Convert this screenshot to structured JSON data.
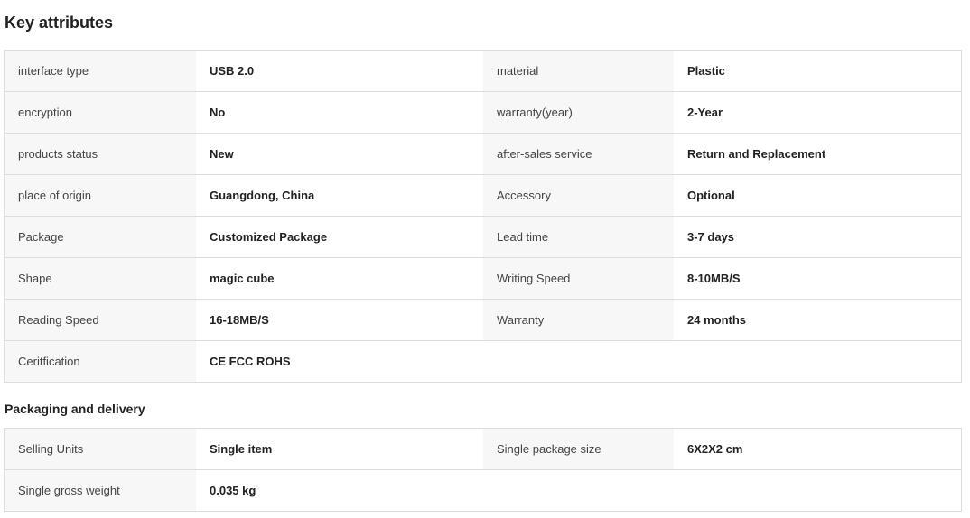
{
  "key_attributes": {
    "title": "Key attributes",
    "rows": [
      {
        "l1": "interface type",
        "v1": "USB 2.0",
        "l2": "material",
        "v2": "Plastic"
      },
      {
        "l1": "encryption",
        "v1": "No",
        "l2": "warranty(year)",
        "v2": "2-Year"
      },
      {
        "l1": "products status",
        "v1": "New",
        "l2": "after-sales service",
        "v2": "Return and Replacement"
      },
      {
        "l1": "place of origin",
        "v1": "Guangdong, China",
        "l2": "Accessory",
        "v2": "Optional"
      },
      {
        "l1": "Package",
        "v1": "Customized Package",
        "l2": "Lead time",
        "v2": "3-7 days"
      },
      {
        "l1": "Shape",
        "v1": "magic cube",
        "l2": "Writing Speed",
        "v2": "8-10MB/S"
      },
      {
        "l1": "Reading Speed",
        "v1": "16-18MB/S",
        "l2": "Warranty",
        "v2": "24 months"
      },
      {
        "l1": "Ceritfication",
        "v1": "CE FCC ROHS"
      }
    ]
  },
  "packaging": {
    "title": "Packaging and delivery",
    "rows": [
      {
        "l1": "Selling Units",
        "v1": "Single item",
        "l2": "Single package size",
        "v2": "6X2X2 cm"
      },
      {
        "l1": "Single gross weight",
        "v1": "0.035 kg"
      }
    ]
  }
}
